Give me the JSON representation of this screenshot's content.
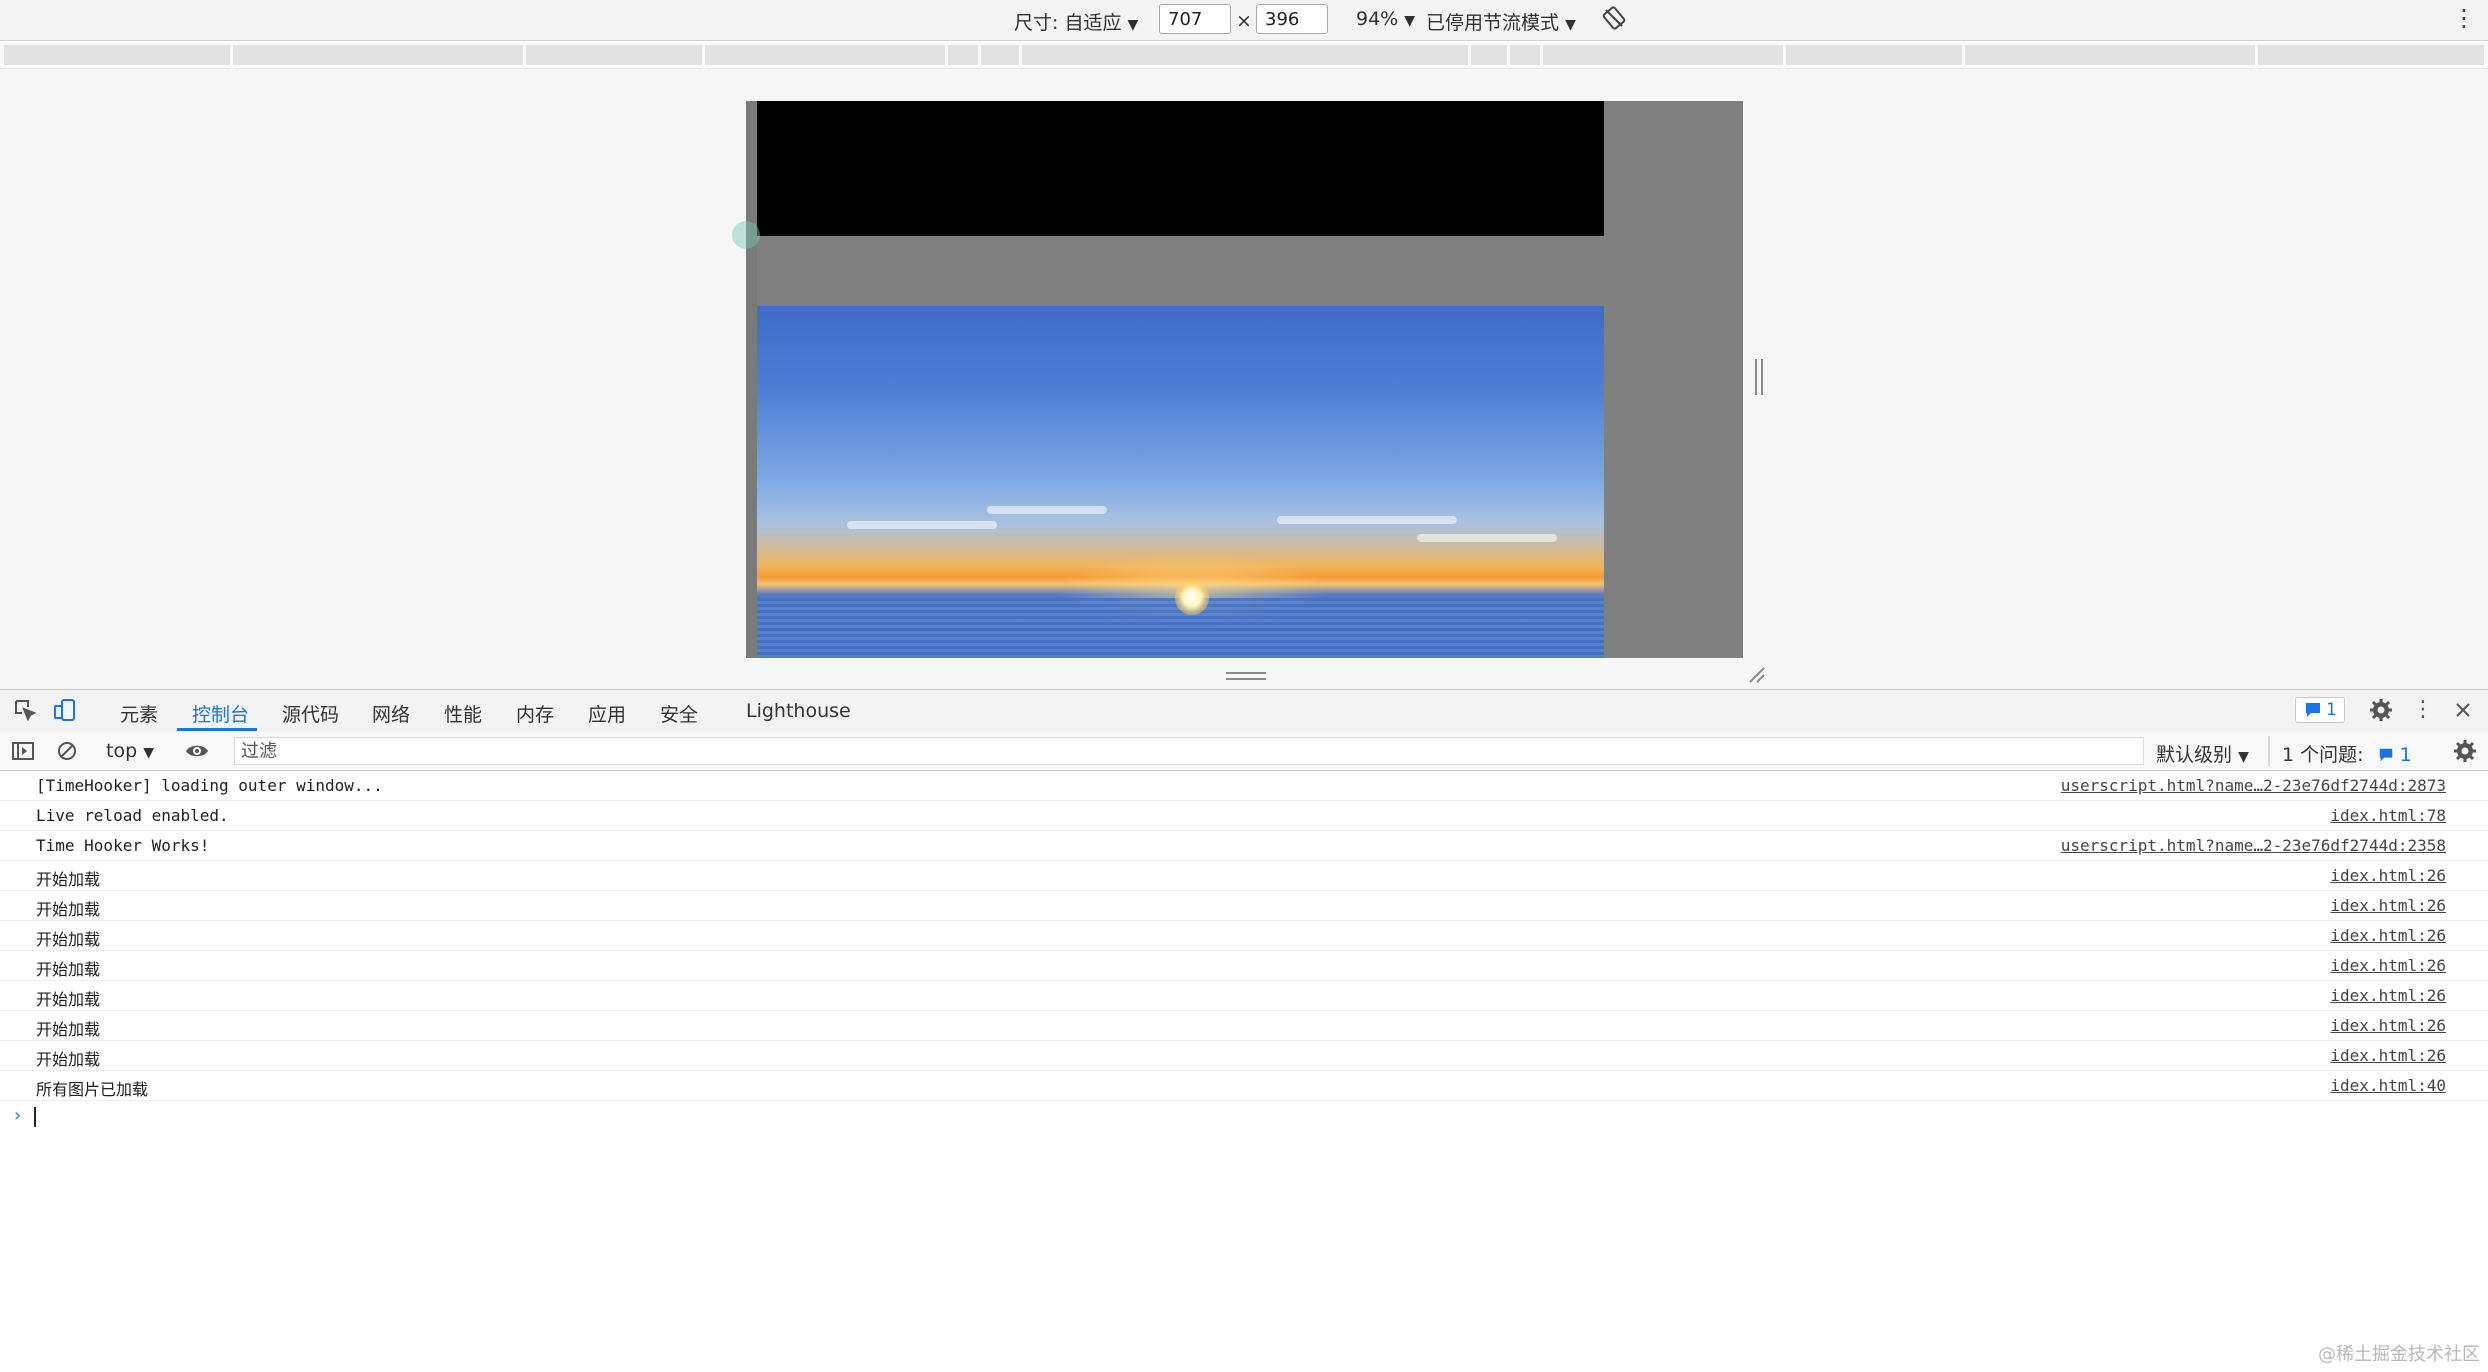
{
  "device_toolbar": {
    "dimensions_label": "尺寸: 自适应",
    "width_value": "707",
    "times_sign": "×",
    "height_value": "396",
    "zoom": "94%",
    "throttle": "已停用节流模式"
  },
  "devtools": {
    "tabs": [
      "元素",
      "控制台",
      "源代码",
      "网络",
      "性能",
      "内存",
      "应用",
      "安全",
      "Lighthouse"
    ],
    "active_tab": "控制台",
    "issues_count": "1"
  },
  "console_toolbar": {
    "context": "top",
    "filter_placeholder": "过滤",
    "level": "默认级别",
    "issues_text": "1 个问题:",
    "issues_count": "1"
  },
  "console": {
    "messages": [
      {
        "text": "[TimeHooker] loading outer window...",
        "source": "userscript.html?name…2-23e76df2744d:2873"
      },
      {
        "text": "Live reload enabled.",
        "source": "idex.html:78"
      },
      {
        "text": "Time Hooker Works!",
        "source": "userscript.html?name…2-23e76df2744d:2358"
      },
      {
        "text": "开始加载",
        "source": "idex.html:26"
      },
      {
        "text": "开始加载",
        "source": "idex.html:26"
      },
      {
        "text": "开始加载",
        "source": "idex.html:26"
      },
      {
        "text": "开始加载",
        "source": "idex.html:26"
      },
      {
        "text": "开始加载",
        "source": "idex.html:26"
      },
      {
        "text": "开始加载",
        "source": "idex.html:26"
      },
      {
        "text": "开始加载",
        "source": "idex.html:26"
      },
      {
        "text": "所有图片已加载",
        "source": "idex.html:40"
      }
    ]
  },
  "watermark": "@稀土掘金技术社区",
  "colors": {
    "accent": "#1a73e8",
    "frame_gray": "#808080"
  }
}
